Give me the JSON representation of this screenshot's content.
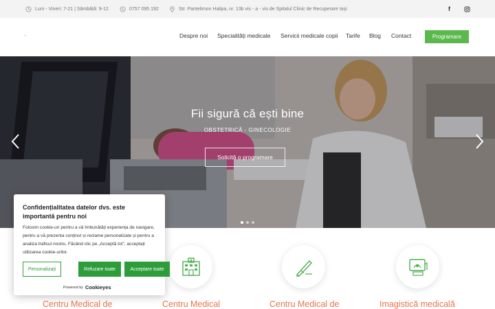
{
  "topbar": {
    "hours": "Luni - Vineri: 7-21 | Sâmbătă: 9-12",
    "phone": "0757 095 192",
    "address": "Str. Pantelimon Halipa, nr. 13b vis - a - vis de Spitalul Clinic de Recuperare Iași",
    "social": {
      "facebook": "f",
      "instagram": "◎"
    }
  },
  "nav": {
    "items": [
      "Despre noi",
      "Specialități medicale",
      "Servicii medicale copii",
      "Tarife",
      "Blog",
      "Contact"
    ],
    "cta": "Programare"
  },
  "hero": {
    "title": "Fii sigură că ești bine",
    "subtitle": "OBSTETRICĂ - GINECOLOGIE",
    "button": "Solicită o programare",
    "prev_icon": "chevron-left-icon",
    "next_icon": "chevron-right-icon",
    "slides_count": 3,
    "active_slide": 1
  },
  "services": [
    {
      "title": "Centru Medical de",
      "icon": "building-icon"
    },
    {
      "title": "Centru Medical",
      "icon": "building-icon"
    },
    {
      "title": "Centru Medical de",
      "icon": "scalpel-icon"
    },
    {
      "title": "Imagistică medicală",
      "icon": "ultrasound-icon"
    }
  ],
  "cookie": {
    "title": "Confidențialitatea datelor dvs. este importantă pentru noi",
    "body": "Folosim cookie-uri pentru a vă îmbunătăți experiența de navigare, pentru a vă prezenta conținut și reclame personalizate și pentru a analiza traficul nostru. Făcând clic pe „Acceptă tot”, acceptați utilizarea cookie-urilor.",
    "btn_customize": "Personalizați",
    "btn_reject": "Refuzare toate",
    "btn_accept": "Acceptare toate",
    "powered_by": "Powered by",
    "brand": "Cookieyes"
  },
  "colors": {
    "green": "#5bb84d",
    "cookie_green": "#2d9d3a",
    "orange": "#e8734d"
  }
}
